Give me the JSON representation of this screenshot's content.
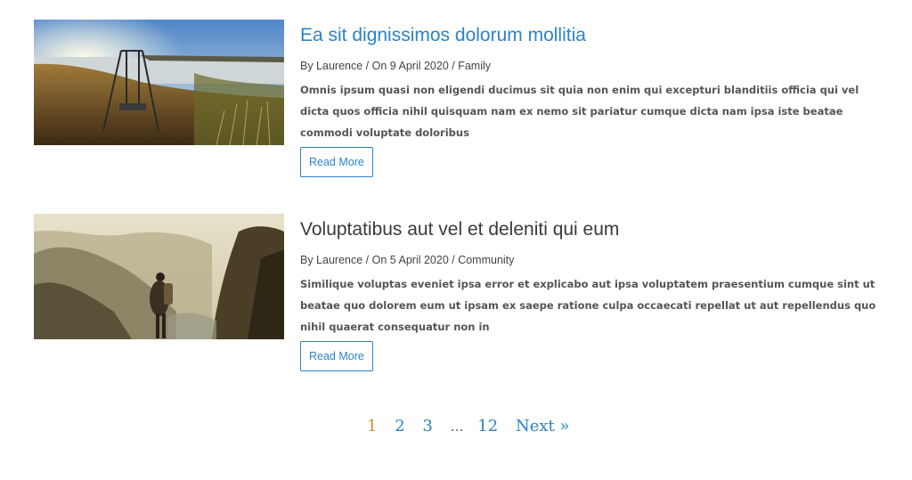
{
  "posts": [
    {
      "title": "Ea sit dignissimos dolorum mollitia",
      "meta": "By Laurence / On 9 April 2020 / Family",
      "excerpt": "Omnis ipsum quasi non eligendi ducimus sit quia non enim qui excepturi blanditiis officia qui vel dicta quos officia nihil quisquam nam ex nemo sit pariatur cumque dicta nam ipsa iste beatae commodi voluptate doloribus",
      "button": "Read More"
    },
    {
      "title": "Voluptatibus aut vel et deleniti qui eum",
      "meta": "By Laurence / On 5 April 2020 / Community",
      "excerpt": "Similique voluptas eveniet ipsa error et explicabo aut ipsa voluptatem praesentium cumque sint ut beatae quo dolorem eum ut ipsam ex saepe ratione culpa occaecati repellat ut aut repellendus quo nihil quaerat consequatur non in",
      "button": "Read More"
    }
  ],
  "pagination": {
    "current": "1",
    "pages": [
      "2",
      "3"
    ],
    "dots": "…",
    "last": "12",
    "next": "Next »"
  },
  "colors": {
    "link": "#2b83c6",
    "current_page": "#d88a3a"
  }
}
